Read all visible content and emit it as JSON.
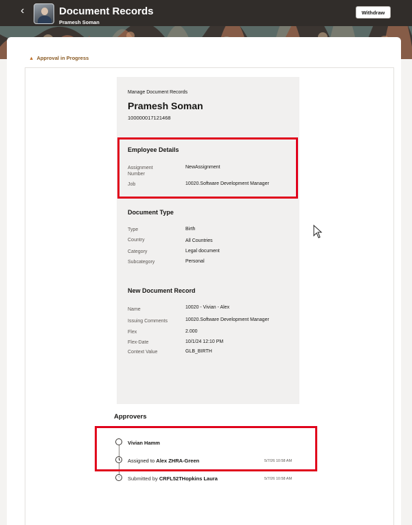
{
  "header": {
    "back_glyph": "‹",
    "title": "Document Records",
    "subtitle": "Pramesh Soman",
    "withdraw_label": "Withdraw"
  },
  "status": {
    "icon": "warning-icon",
    "text": "Approval in Progress"
  },
  "document": {
    "heading": "Manage Document Records",
    "person_name": "Pramesh Soman",
    "person_number": "100000017121468",
    "employee_details": {
      "title": "Employee Details",
      "fields": [
        {
          "label": "Assignment Number",
          "value": "NewAssignment"
        },
        {
          "label": "Job",
          "value": "10020.Software Development Manager"
        }
      ]
    },
    "document_type": {
      "title": "Document Type",
      "fields": [
        {
          "label": "Type",
          "value": "Birth"
        },
        {
          "label": "Country",
          "value": "All Countries"
        },
        {
          "label": "Category",
          "value": "Legal document"
        },
        {
          "label": "Subcategory",
          "value": "Personal"
        }
      ]
    },
    "new_record": {
      "title": "New Document Record",
      "fields": [
        {
          "label": "Name",
          "value": "10020 - Vivian - Alex"
        },
        {
          "label": "Issuing Comments",
          "value": "10020.Software Development Manager"
        },
        {
          "label": "Flex",
          "value": "2.000"
        },
        {
          "label": "Flex-Date",
          "value": "10/1/24 12:10 PM"
        },
        {
          "label": "Context Value",
          "value": "GLB_BIRTH"
        }
      ]
    }
  },
  "approvers": {
    "title": "Approvers",
    "items": [
      {
        "name": "Vivian Hamm",
        "prefix": "",
        "timestamp": ""
      },
      {
        "prefix": "Assigned to ",
        "name": "Alex ZHRA-Green",
        "timestamp": "5/7/26 10:58 AM"
      },
      {
        "prefix": "Submitted by ",
        "name": "CRFL52THopkins Laura",
        "timestamp": "5/7/26 10:58 AM"
      }
    ]
  },
  "colors": {
    "header_bg": "#312d2a",
    "highlight": "#e0001b",
    "status_text": "#8a5a23"
  }
}
